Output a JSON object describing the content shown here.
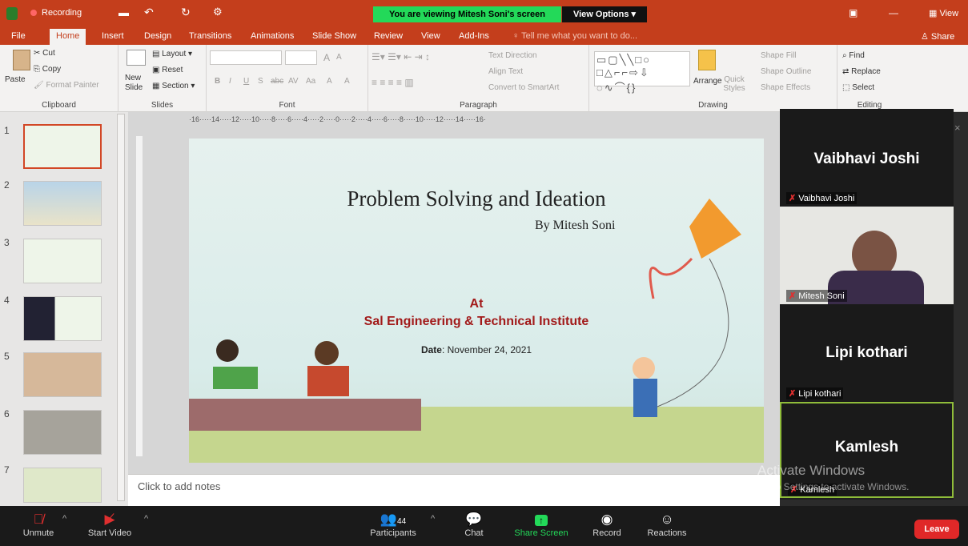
{
  "title_bar": {
    "recording": "Recording",
    "banner": "You are viewing Mitesh Soni's screen",
    "view_options": "View Options",
    "view": "View"
  },
  "tabs": [
    "File",
    "Home",
    "Insert",
    "Design",
    "Transitions",
    "Animations",
    "Slide Show",
    "Review",
    "View",
    "Add-Ins"
  ],
  "tell_me": "Tell me what you want to do...",
  "share": "Share",
  "ribbon": {
    "clipboard": {
      "label": "Clipboard",
      "paste": "Paste",
      "cut": "Cut",
      "copy": "Copy",
      "format_painter": "Format Painter"
    },
    "slides": {
      "label": "Slides",
      "new_slide": "New Slide",
      "layout": "Layout",
      "reset": "Reset",
      "section": "Section"
    },
    "font": {
      "label": "Font",
      "bold": "B",
      "italic": "I",
      "underline": "U",
      "shadow": "S",
      "strike": "abc",
      "clear": "A",
      "spacing": "AV",
      "case": "Aa",
      "color": "A",
      "grow": "A",
      "shrink": "A"
    },
    "paragraph": {
      "label": "Paragraph",
      "text_direction": "Text Direction",
      "align_text": "Align Text",
      "convert": "Convert to SmartArt"
    },
    "drawing": {
      "label": "Drawing",
      "arrange": "Arrange",
      "quick_styles": "Quick Styles",
      "shape_fill": "Shape Fill",
      "shape_outline": "Shape Outline",
      "shape_effects": "Shape Effects"
    },
    "editing": {
      "label": "Editing",
      "find": "Find",
      "replace": "Replace",
      "select": "Select"
    }
  },
  "ruler": "·16·····14·····12·····10·····8·····6·····4·····2·····0·····2·····4·····6·····8·····10·····12·····14·····16·",
  "thumbnails": [
    "1",
    "2",
    "3",
    "4",
    "5",
    "6",
    "7"
  ],
  "slide": {
    "title": "Problem Solving and Ideation",
    "byline": "By Mitesh Soni",
    "at": "At",
    "institute": "Sal Engineering & Technical Institute",
    "date_label": "Date",
    "date_value": ": November 24, 2021"
  },
  "notes_placeholder": "Click to add notes",
  "participants": [
    {
      "name": "Vaibhavi Joshi",
      "label": "Vaibhavi Joshi"
    },
    {
      "name": "",
      "label": "Mitesh Soni"
    },
    {
      "name": "Lipi kothari",
      "label": "Lipi kothari"
    },
    {
      "name": "Kamlesh",
      "label": "Kamlesh"
    }
  ],
  "watermark": {
    "line1": "Activate Windows",
    "line2": "Go to Settings to activate Windows."
  },
  "zoom_bar": {
    "unmute": "Unmute",
    "start_video": "Start Video",
    "participants": "Participants",
    "participants_count": "44",
    "chat": "Chat",
    "share_screen": "Share Screen",
    "record": "Record",
    "reactions": "Reactions",
    "leave": "Leave"
  },
  "colors": {
    "office_red": "#c43e1c",
    "zoom_green": "#23d959",
    "leave_red": "#e02828",
    "active_border": "#8fbc3a"
  }
}
